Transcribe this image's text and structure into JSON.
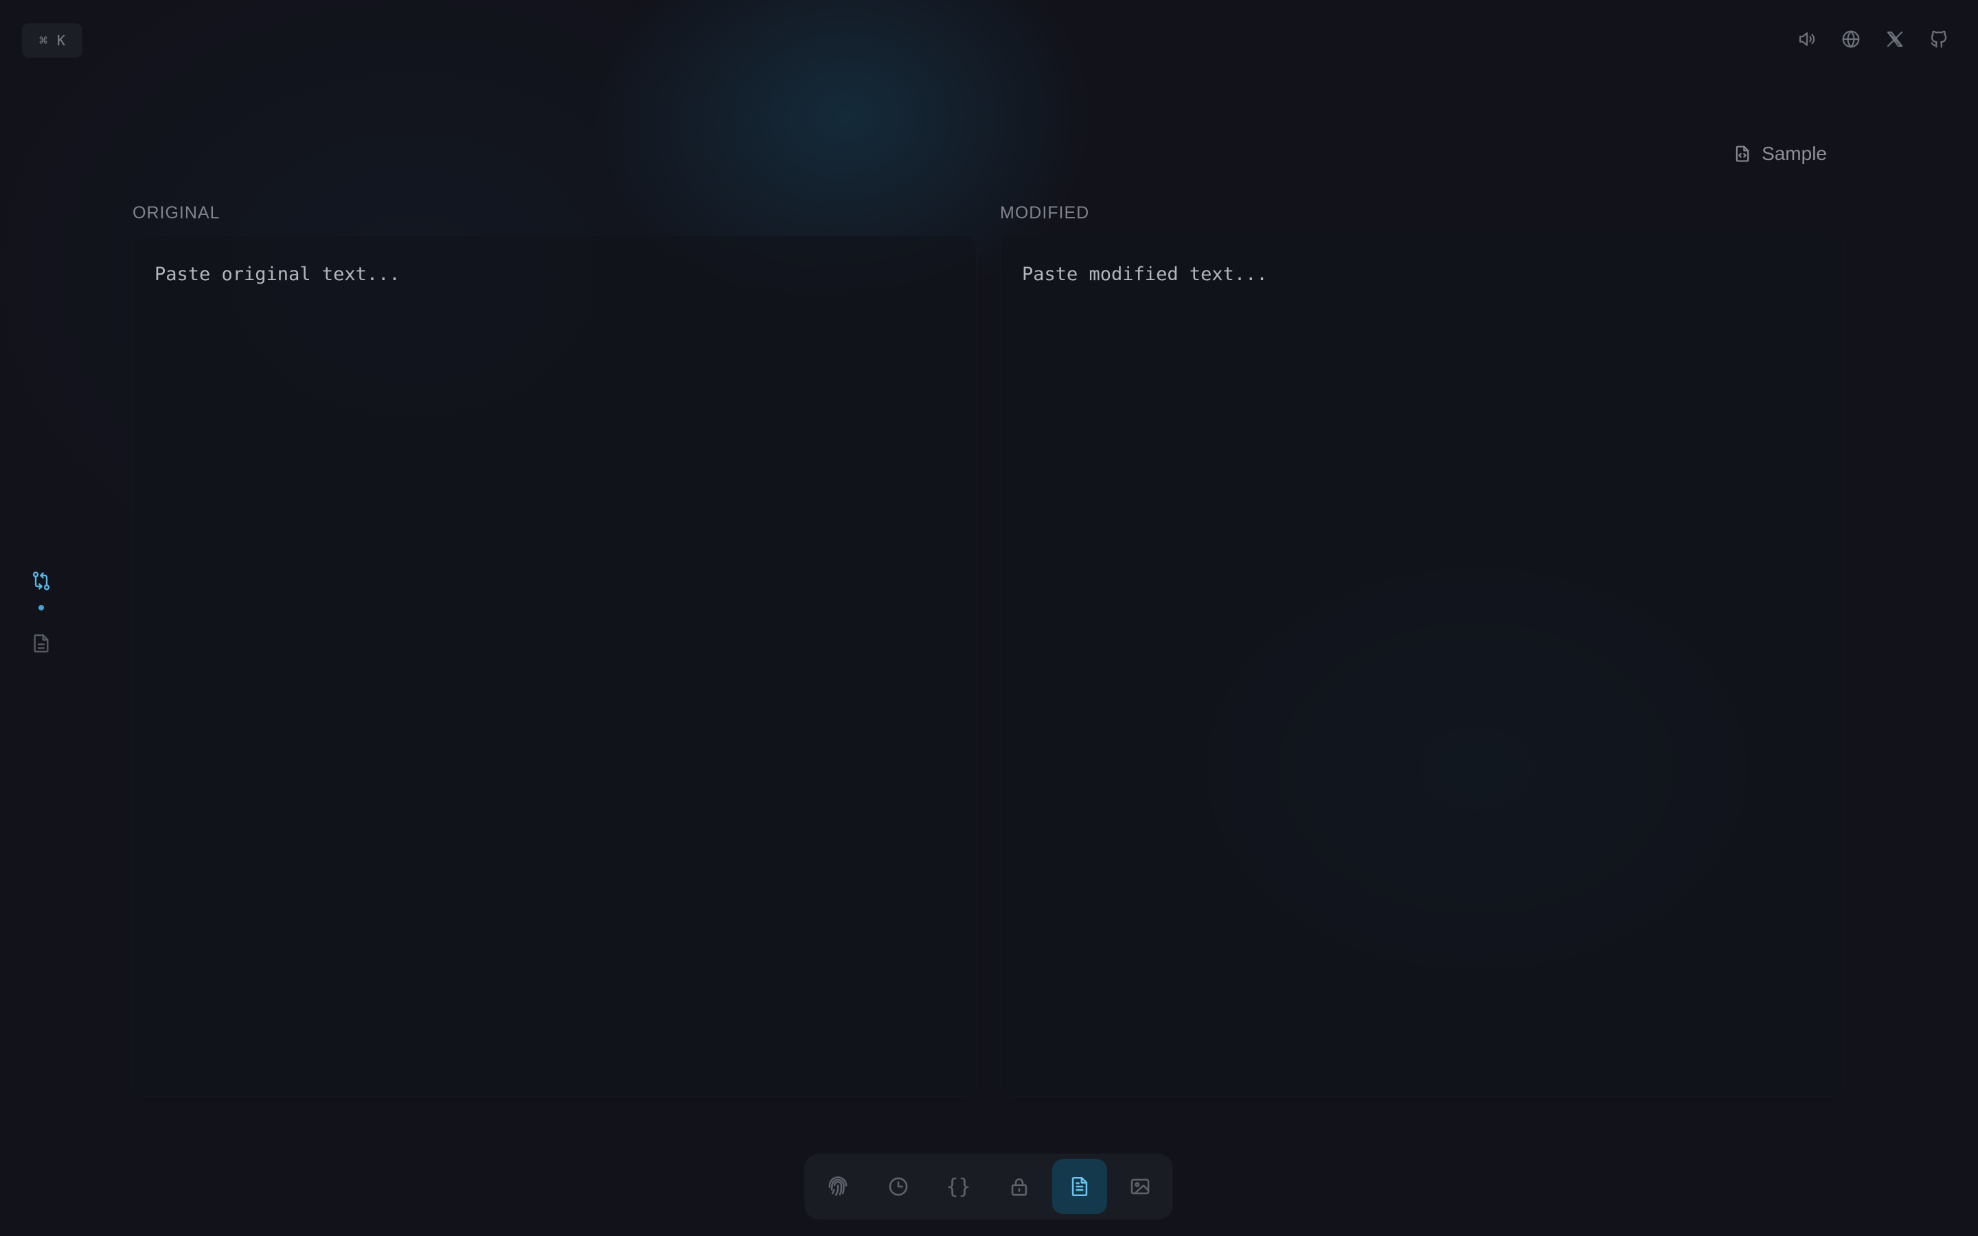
{
  "shortcut": {
    "symbol": "⌘",
    "key": "K"
  },
  "header_icons": [
    "speaker-icon",
    "globe-icon",
    "x-logo-icon",
    "github-icon"
  ],
  "sample_button": {
    "label": "Sample",
    "icon": "file-code-icon"
  },
  "editors": {
    "original": {
      "label": "ORIGINAL",
      "placeholder": "Paste original text..."
    },
    "modified": {
      "label": "MODIFIED",
      "placeholder": "Paste modified text..."
    }
  },
  "side_rail": [
    {
      "icon": "compare-icon",
      "active": true
    },
    {
      "icon": "document-icon",
      "active": false
    }
  ],
  "dock": {
    "items": [
      {
        "icon": "fingerprint-icon",
        "active": false
      },
      {
        "icon": "clock-icon",
        "active": false
      },
      {
        "icon": "braces-icon",
        "glyph": "{}",
        "active": false
      },
      {
        "icon": "lock-icon",
        "active": false
      },
      {
        "icon": "document-text-icon",
        "active": true
      },
      {
        "icon": "image-icon",
        "active": false
      }
    ]
  },
  "colors": {
    "background": "#12121a",
    "accent": "#5ab8e6",
    "active_dock_bg": "#14394d",
    "panel_bg": "#10141b"
  }
}
